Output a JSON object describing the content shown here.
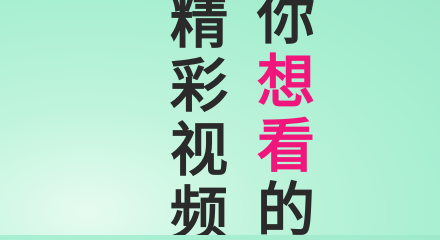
{
  "banner": {
    "left_column": [
      "精",
      "彩",
      "视",
      "频"
    ],
    "right_column": [
      {
        "char": "你",
        "accent": false
      },
      {
        "char": "想",
        "accent": true
      },
      {
        "char": "看",
        "accent": true
      },
      {
        "char": "的",
        "accent": false
      }
    ]
  },
  "colors": {
    "text": "#2a2a2a",
    "accent": "#f0167b",
    "background": "#a9efd2"
  }
}
